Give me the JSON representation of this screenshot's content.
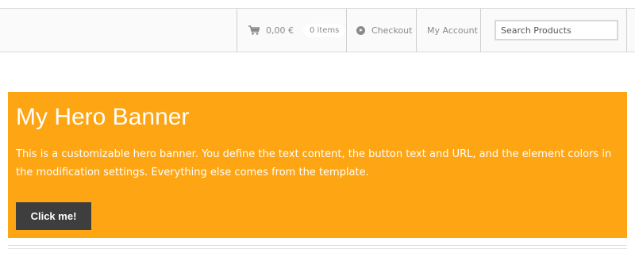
{
  "header": {
    "cart": {
      "total": "0,00 €",
      "items": "0 items",
      "icon": "cart-icon"
    },
    "checkout": {
      "label": "Checkout",
      "icon": "play-circle-icon"
    },
    "account": {
      "label": "My Account"
    },
    "search": {
      "placeholder": "Search Products",
      "value": ""
    }
  },
  "hero": {
    "title": "My Hero Banner",
    "text": "This is a customizable hero banner. You define the text content, the button text and URL, and the element colors in the modification settings. Everything else comes from the template.",
    "button_label": "Click me!"
  },
  "colors": {
    "hero_background": "#fea514",
    "button_background": "#3e3e3e",
    "nav_text": "#8a8a8a"
  }
}
